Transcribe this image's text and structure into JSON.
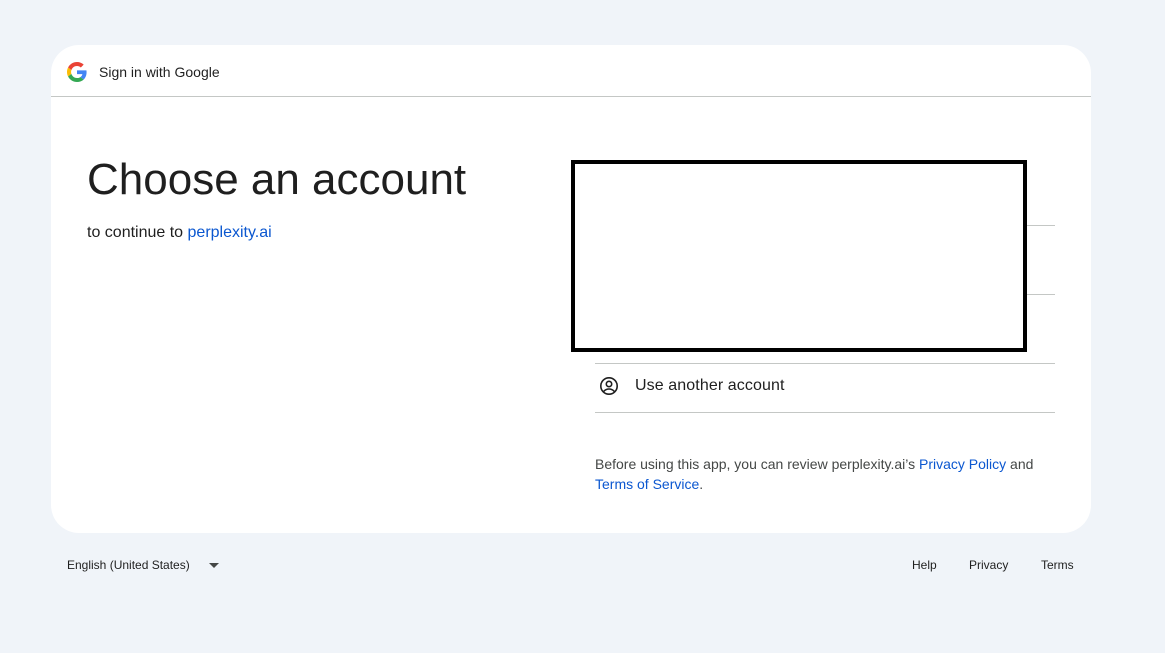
{
  "header": {
    "title": "Sign in with Google",
    "logo_icon": "google-g-icon"
  },
  "main": {
    "heading": "Choose an account",
    "subheading_prefix": "to continue to ",
    "app_link": "perplexity.ai"
  },
  "accounts": {
    "use_another_label": "Use another account",
    "use_another_icon": "account-circle-icon"
  },
  "disclaimer": {
    "text_prefix": "Before using this app, you can review perplexity.ai’s ",
    "privacy_policy": "Privacy Policy",
    "and": " and ",
    "terms_of_service": "Terms of Service",
    "period": "."
  },
  "footer": {
    "language": "English (United States)",
    "links": {
      "help": "Help",
      "privacy": "Privacy",
      "terms": "Terms"
    }
  },
  "colors": {
    "background": "#f0f4f9",
    "card": "#ffffff",
    "link": "#0b57d0",
    "text": "#1f1f1f",
    "divider": "#c4c7c5"
  }
}
